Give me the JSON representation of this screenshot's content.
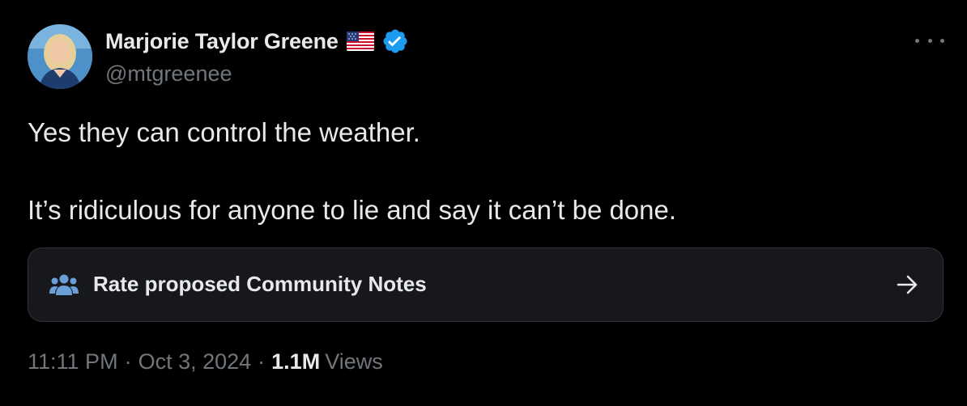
{
  "author": {
    "display_name": "Marjorie Taylor Greene",
    "handle": "@mtgreenee",
    "flag_icon": "us-flag-icon",
    "verified_icon": "verified-badge-icon"
  },
  "tweet": {
    "paragraphs": [
      "Yes they can control the weather.",
      "It’s ridiculous for anyone to lie and say it can’t be done."
    ]
  },
  "community_notes": {
    "label": "Rate proposed Community Notes",
    "icon": "people-icon",
    "arrow_icon": "arrow-right-icon"
  },
  "meta": {
    "time": "11:11 PM",
    "separator": "·",
    "date": "Oct 3, 2024",
    "views_count": "1.1M",
    "views_label": "Views"
  },
  "colors": {
    "background": "#000000",
    "text_primary": "#e7e9ea",
    "text_secondary": "#71767b",
    "verified_blue": "#1d9bf0",
    "card_background": "#16181c",
    "card_border": "#2f3336",
    "notes_icon_blue": "#6b9fd8"
  }
}
